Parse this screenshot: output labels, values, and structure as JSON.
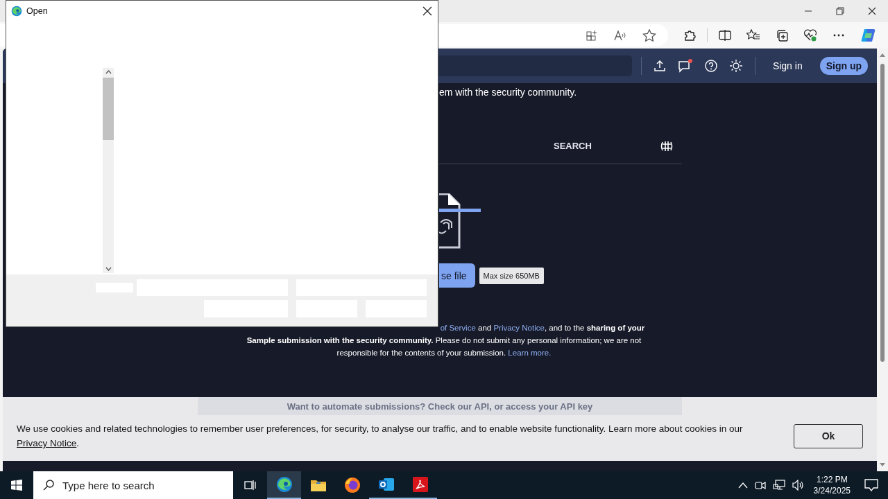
{
  "browser": {
    "header": {
      "notifications_unread": true,
      "sign_in": "Sign in",
      "sign_up": "Sign up"
    },
    "page": {
      "intro_fragment": "em with the security community.",
      "tabs": [
        {
          "label": "SEARCH"
        }
      ],
      "choose_button": "se file",
      "max_size": "Max size 650MB",
      "consent": [
        {
          "kind": "link",
          "text": "of Service"
        },
        {
          "kind": "text",
          "text": " and "
        },
        {
          "kind": "link",
          "text": "Privacy Notice"
        },
        {
          "kind": "text",
          "text": ", and to the "
        },
        {
          "kind": "bold",
          "text": "sharing of your Sample submission with the security community."
        },
        {
          "kind": "text",
          "text": " Please do not submit any personal information; we are not responsible for the contents of your submission. "
        },
        {
          "kind": "link",
          "text": "Learn more."
        }
      ],
      "api_strip": "Want to automate submissions? Check our API, or access your API key"
    },
    "cookie_banner": {
      "text": "We use cookies and related technologies to remember user preferences, for security, to analyse our traffic, and to enable website functionality. Learn more about cookies in our ",
      "link": "Privacy Notice",
      "end": ".",
      "button": "Ok"
    }
  },
  "dialog": {
    "title": "Open"
  },
  "taskbar": {
    "search_placeholder": "Type here to search",
    "apps": [
      {
        "kind": "task-view",
        "running": false,
        "active": false
      },
      {
        "kind": "edge",
        "running": true,
        "active": true
      },
      {
        "kind": "explorer",
        "running": false,
        "active": false
      },
      {
        "kind": "firefox",
        "running": false,
        "active": false
      },
      {
        "kind": "outlook",
        "running": true,
        "active": false
      },
      {
        "kind": "acrobat",
        "running": true,
        "active": false
      }
    ],
    "time": "1:22 PM",
    "date": "3/24/2025"
  }
}
